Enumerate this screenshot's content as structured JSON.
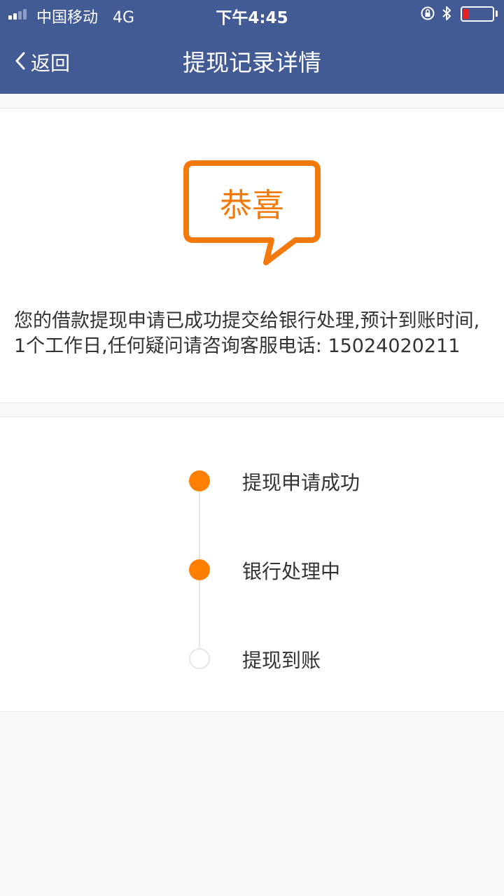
{
  "status_bar": {
    "carrier": "中国移动",
    "network": "4G",
    "time": "下午4:45",
    "battery_color": "#e82121"
  },
  "header": {
    "back_label": "返回",
    "title": "提现记录详情",
    "background": "#435b94"
  },
  "congrats": {
    "badge_text": "恭喜",
    "accent": "#f3790b",
    "message": "您的借款提现申请已成功提交给银行处理,预计到账时间,1个工作日,任何疑问请咨询客服电话: 15024020211"
  },
  "steps": [
    {
      "label": "提现申请成功",
      "state": "done"
    },
    {
      "label": "银行处理中",
      "state": "done"
    },
    {
      "label": "提现到账",
      "state": "pending"
    }
  ],
  "colors": {
    "step_active": "#ff8000",
    "step_pending_border": "#e6e6e6"
  }
}
